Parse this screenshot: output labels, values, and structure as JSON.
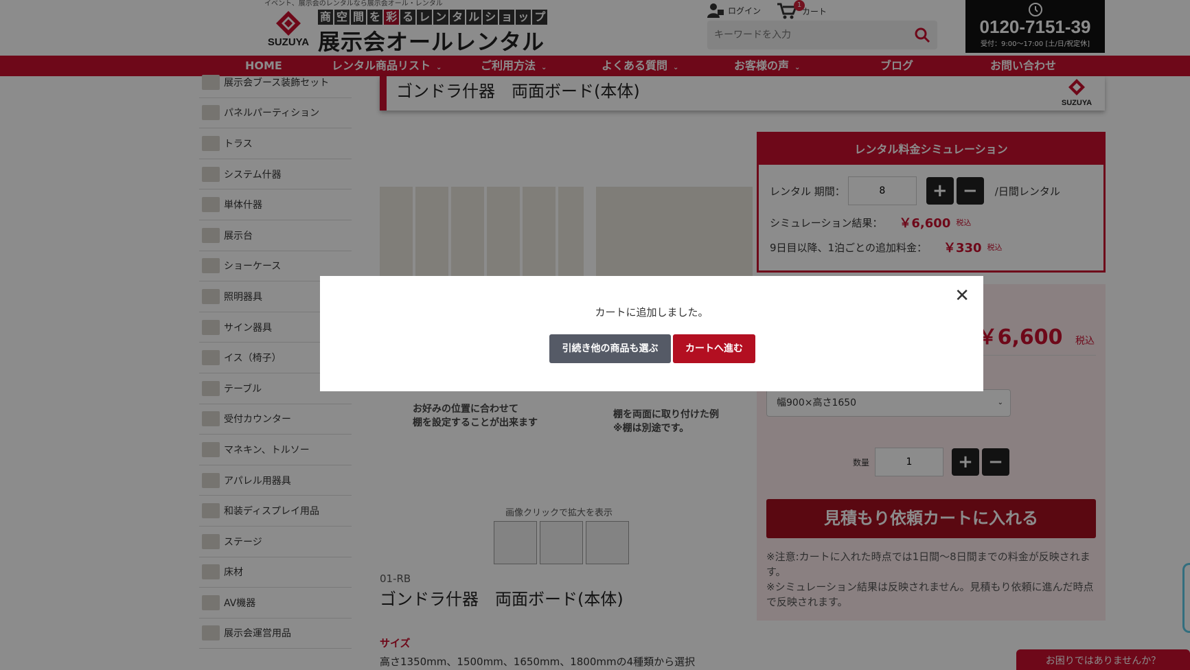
{
  "header": {
    "tagline": "イベント、展示会のレンタルなら展示会オール・レンタル",
    "logo_brand": "SUZUYA",
    "logo_sub_chars": [
      "商",
      "空",
      "間",
      "を",
      "彩",
      "る",
      "レ",
      "ン",
      "タ",
      "ル",
      "シ",
      "ョ",
      "ッ",
      "プ"
    ],
    "logo_sub_red_index": 4,
    "logo_main": "展示会オールレンタル",
    "login_label": "ログイン",
    "cart_label": "カート",
    "cart_count": "1",
    "search_placeholder": "キーワードを入力",
    "phone": "0120-7151-39",
    "phone_hours": "受付：9:00〜17:00 [土/日/祝定休]"
  },
  "nav": [
    {
      "label": "HOME",
      "dropdown": false
    },
    {
      "label": "レンタル商品リスト",
      "dropdown": true
    },
    {
      "label": "ご利用方法",
      "dropdown": true
    },
    {
      "label": "よくある質問",
      "dropdown": true
    },
    {
      "label": "お客様の声",
      "dropdown": true
    },
    {
      "label": "ブログ",
      "dropdown": false
    },
    {
      "label": "お問い合わせ",
      "dropdown": false
    }
  ],
  "sidebar": [
    "展示会ブース装飾セット",
    "パネルパーティション",
    "トラス",
    "システム什器",
    "単体什器",
    "展示台",
    "ショーケース",
    "照明器具",
    "サイン器具",
    "イス（椅子）",
    "テーブル",
    "受付カウンター",
    "マネキン、トルソー",
    "アパレル用器具",
    "和装ディスプレイ用品",
    "ステージ",
    "床材",
    "AV機器",
    "展示会運営用品"
  ],
  "product": {
    "title": "ゴンドラ什器　両面ボード(本体)",
    "code": "01-RB",
    "name": "ゴンドラ什器　両面ボード(本体)",
    "caption1": "お好みの位置に合わせて\n棚を設定することが出来ます",
    "caption2": "棚を両面に取り付けた例\n※棚は別途です。",
    "zoom_hint": "画像クリックで拡大を表示",
    "size_heading": "サイズ",
    "size_text": "高さ1350mm、1500mm、1650mm、1800mmの4種類から選択"
  },
  "simulation": {
    "heading": "レンタル料金シミュレーション",
    "period_label": "レンタル 期間：",
    "period_value": "8",
    "period_suffix": "/日間レンタル",
    "result_label": "シミュレーション結果：",
    "result_price": "￥6,600",
    "tax_label": "税込",
    "extra_label": "9日目以降、1泊ごとの追加料金：",
    "extra_price": "￥330"
  },
  "cart_panel": {
    "price": "￥6,600",
    "tax_label": "税込",
    "size_option": "幅900×高さ1650",
    "qty_label": "数量",
    "qty_value": "1",
    "quote_button": "見積もり依頼カートに入れる",
    "note": "※注意:カートに入れた時点では1日間〜8日間までの料金が反映されます。\n※シミュレーション結果は反映されません。見積もり依頼に進んだ時点で反映されます。"
  },
  "help_label": "お困りではありませんか？",
  "modal": {
    "message": "カートに追加しました。",
    "continue_button": "引続き他の商品も選ぶ",
    "cart_button": "カートへ進む",
    "close_symbol": "✕"
  },
  "colors": {
    "accent": "#c8102e",
    "dark": "#222222",
    "overlay": "rgba(0,0,0,0.45)"
  }
}
